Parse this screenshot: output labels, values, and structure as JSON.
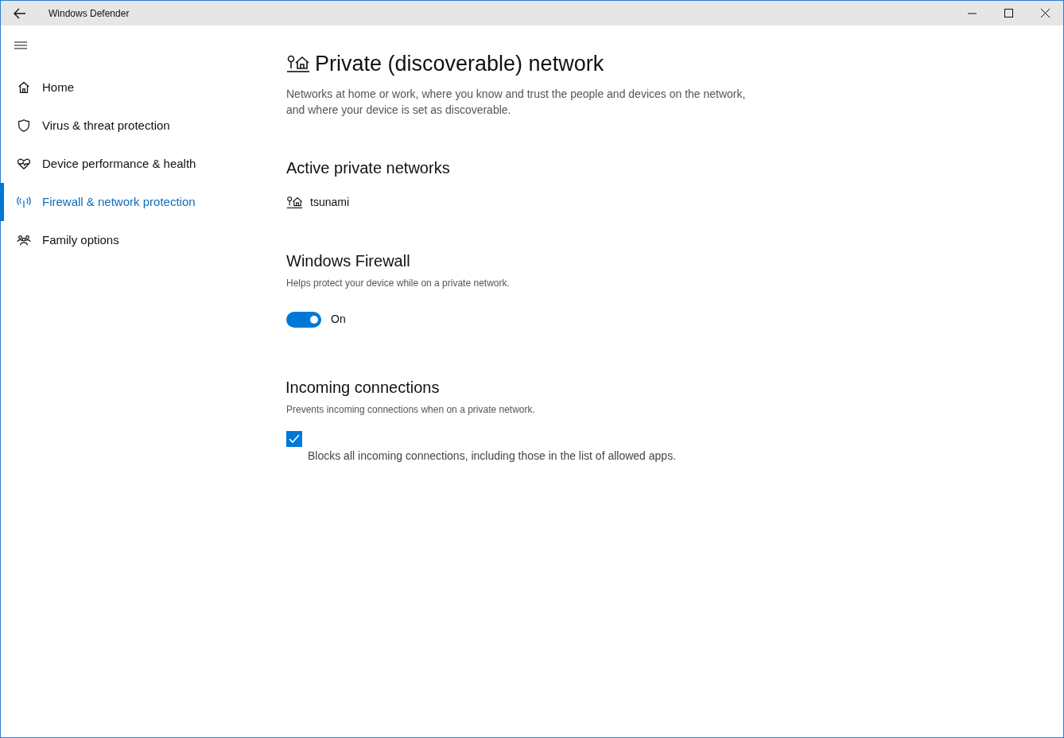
{
  "window": {
    "title": "Windows Defender"
  },
  "sidebar": {
    "items": [
      {
        "label": "Home",
        "selected": false
      },
      {
        "label": "Virus & threat protection",
        "selected": false
      },
      {
        "label": "Device performance & health",
        "selected": false
      },
      {
        "label": "Firewall & network protection",
        "selected": true
      },
      {
        "label": "Family options",
        "selected": false
      }
    ]
  },
  "page": {
    "title": "Private (discoverable) network",
    "description": "Networks at home or work, where you know and trust the people and devices on the network, and where your device is set as discoverable."
  },
  "active_networks": {
    "heading": "Active private networks",
    "networks": [
      "tsunami"
    ]
  },
  "firewall": {
    "heading": "Windows Firewall",
    "description": "Helps protect your device while on a private network.",
    "on": true,
    "state_label": "On"
  },
  "incoming": {
    "heading": "Incoming connections",
    "description": "Prevents incoming connections when on a private network.",
    "checked": true,
    "label": "Blocks all incoming connections, including those in the list of allowed apps."
  }
}
